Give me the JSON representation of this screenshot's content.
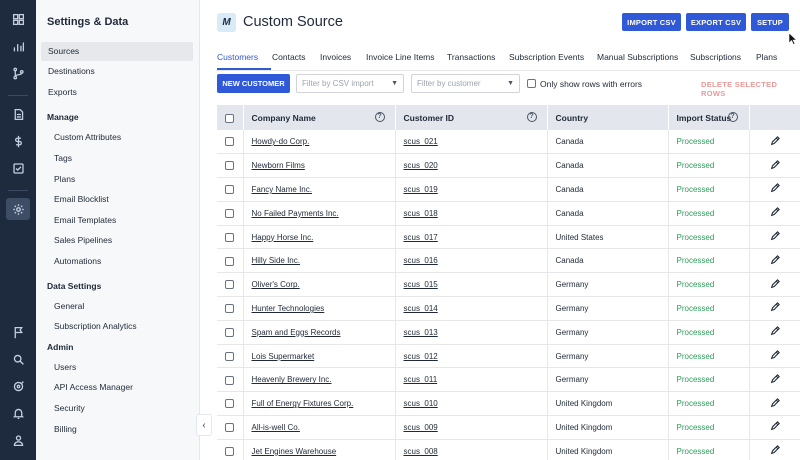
{
  "rail": {
    "icons": [
      "grid-icon",
      "bar-chart-icon",
      "branch-icon",
      "document-icon",
      "dollar-icon",
      "checkbox-icon",
      "settings-icon",
      "flag-icon",
      "search-icon",
      "target-icon",
      "bell-icon",
      "user-icon"
    ],
    "active": "settings-icon"
  },
  "sidebar": {
    "title": "Settings & Data",
    "top_items": [
      "Sources",
      "Destinations",
      "Exports"
    ],
    "sections": [
      {
        "heading": "Manage",
        "items": [
          "Custom Attributes",
          "Tags",
          "Plans",
          "Email Blocklist",
          "Email Templates",
          "Sales Pipelines",
          "Automations"
        ]
      },
      {
        "heading": "Data Settings",
        "items": [
          "General",
          "Subscription Analytics"
        ]
      },
      {
        "heading": "Admin",
        "items": [
          "Users",
          "API Access Manager",
          "Security",
          "Billing"
        ]
      }
    ],
    "collapse_glyph": "‹"
  },
  "header": {
    "logo_letter": "M",
    "title": "Custom Source",
    "import_csv": "IMPORT CSV",
    "export_csv": "EXPORT CSV",
    "setup": "SETUP"
  },
  "tabs": [
    "Customers",
    "Contacts",
    "Invoices",
    "Invoice Line Items",
    "Transactions",
    "Subscription Events",
    "Manual Subscriptions",
    "Subscriptions",
    "Plans"
  ],
  "toolbar": {
    "new_customer": "NEW CUSTOMER",
    "filter_csv_placeholder": "Filter by CSV import",
    "filter_customer_placeholder": "Filter by customer",
    "errors_only_label": "Only show rows with errors",
    "delete_selected": "DELETE SELECTED ROWS"
  },
  "table": {
    "headers": [
      "Company Name",
      "Customer ID",
      "Country",
      "Import Status"
    ],
    "rows": [
      {
        "company": "Howdy-do Corp.",
        "id": "scus_021",
        "country": "Canada",
        "status": "Processed"
      },
      {
        "company": "Newborn Films",
        "id": "scus_020",
        "country": "Canada",
        "status": "Processed"
      },
      {
        "company": "Fancy Name Inc.",
        "id": "scus_019",
        "country": "Canada",
        "status": "Processed"
      },
      {
        "company": "No Failed Payments Inc.",
        "id": "scus_018",
        "country": "Canada",
        "status": "Processed"
      },
      {
        "company": "Happy Horse Inc.",
        "id": "scus_017",
        "country": "United States",
        "status": "Processed"
      },
      {
        "company": "Hilly Side Inc.",
        "id": "scus_016",
        "country": "Canada",
        "status": "Processed"
      },
      {
        "company": "Oliver's Corp.",
        "id": "scus_015",
        "country": "Germany",
        "status": "Processed"
      },
      {
        "company": "Hunter Technologies",
        "id": "scus_014",
        "country": "Germany",
        "status": "Processed"
      },
      {
        "company": "Spam and Eggs Records",
        "id": "scus_013",
        "country": "Germany",
        "status": "Processed"
      },
      {
        "company": "Lois Supermarket",
        "id": "scus_012",
        "country": "Germany",
        "status": "Processed"
      },
      {
        "company": "Heavenly Brewery Inc.",
        "id": "scus_011",
        "country": "Germany",
        "status": "Processed"
      },
      {
        "company": "Full of Energy Fixtures Corp.",
        "id": "scus_010",
        "country": "United Kingdom",
        "status": "Processed"
      },
      {
        "company": "All-is-well Co.",
        "id": "scus_009",
        "country": "United Kingdom",
        "status": "Processed"
      },
      {
        "company": "Jet Engines Warehouse",
        "id": "scus_008",
        "country": "United Kingdom",
        "status": "Processed"
      }
    ]
  },
  "colors": {
    "accent": "#2f59d6",
    "rail": "#1e2a3e",
    "processed": "#2e9b5b",
    "delete": "#e89a9a"
  }
}
